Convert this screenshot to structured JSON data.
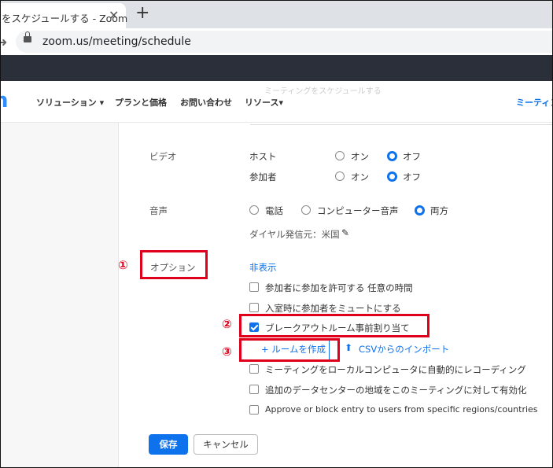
{
  "browser": {
    "tab_title": "をスケジュールする - Zoom",
    "close_glyph": "✕",
    "newtab_glyph": "+",
    "url": "zoom.us/meeting/schedule"
  },
  "nav": {
    "logo": "n",
    "items": [
      "ソリューション ▾",
      "プランと価格",
      "お問い合わせ",
      "リソース▾"
    ],
    "right": "ミーティン",
    "ghost": "ミーティングをスケジュールする"
  },
  "video": {
    "label": "ビデオ",
    "host_label": "ホスト",
    "participant_label": "参加者",
    "on": "オン",
    "off": "オフ"
  },
  "audio": {
    "label": "音声",
    "options": [
      "電話",
      "コンピューター音声",
      "両方"
    ],
    "selected": "両方",
    "dial_from": "ダイヤル発信元：米国"
  },
  "options": {
    "label": "オプション",
    "hide": "非表示",
    "items": [
      {
        "label": "参加者に参加を許可する 任意の時間",
        "checked": false
      },
      {
        "label": "入室時に参加者をミュートにする",
        "checked": false
      },
      {
        "label": "ブレークアウトルーム事前割り当て",
        "checked": true
      }
    ],
    "add_room": "+  ルームを作成",
    "csv_import": "CSVからのインポート",
    "more": [
      {
        "label": "ミーティングをローカルコンピュータに自動的にレコーディング",
        "checked": false
      },
      {
        "label": "追加のデータセンターの地域をこのミーティングに対して有効化",
        "checked": false
      },
      {
        "label": "Approve or block entry to users from specific regions/countries",
        "checked": false
      }
    ]
  },
  "actions": {
    "save": "保存",
    "cancel": "キャンセル"
  },
  "annotations": {
    "step1": "①",
    "step2": "②",
    "step3": "③"
  },
  "colors": {
    "accent": "#0e72ed",
    "annotation": "#e0001b",
    "bookmark_bar": "#2b2f3a"
  }
}
